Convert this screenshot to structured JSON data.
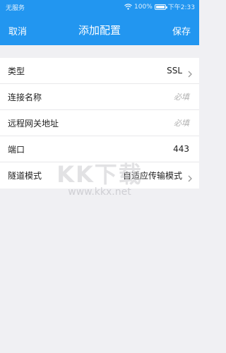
{
  "status_bar": {
    "carrier": "无服务",
    "battery": "100%",
    "time": "下午2:33"
  },
  "nav": {
    "cancel_label": "取消",
    "title": "添加配置",
    "save_label": "保存"
  },
  "form": {
    "rows": [
      {
        "label": "类型",
        "value": "SSL",
        "hint": false,
        "chevron": true
      },
      {
        "label": "连接名称",
        "value": "必填",
        "hint": true,
        "chevron": false
      },
      {
        "label": "远程网关地址",
        "value": "必填",
        "hint": true,
        "chevron": false
      },
      {
        "label": "端口",
        "value": "443",
        "hint": false,
        "chevron": false
      },
      {
        "label": "隧道模式",
        "value": "自适应传输模式",
        "hint": false,
        "chevron": true
      }
    ]
  },
  "watermark": {
    "logo": "KK下载",
    "url": "www.kkx.net"
  },
  "colors": {
    "header": "#2296f0",
    "background": "#f0f0f3"
  },
  "icons": {
    "wifi": "wifi-icon",
    "battery": "battery-icon",
    "chevron": "chevron-right-icon"
  }
}
